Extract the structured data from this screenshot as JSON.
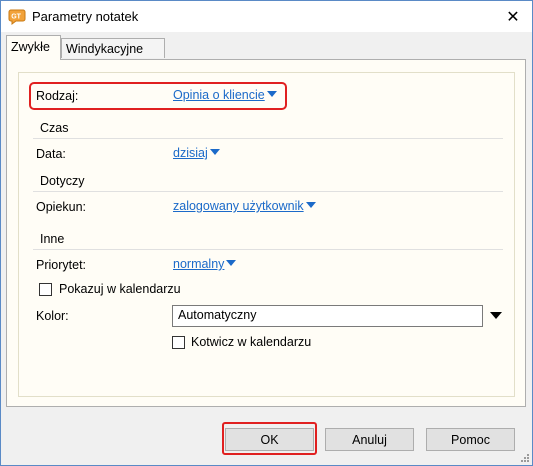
{
  "window": {
    "title": "Parametry notatek",
    "close_symbol": "✕"
  },
  "tabs": [
    {
      "label": "Zwykłe",
      "active": true
    },
    {
      "label": "Windykacyjne",
      "active": false
    }
  ],
  "form": {
    "rodzaj": {
      "label": "Rodzaj:",
      "value": "Opinia o kliencie"
    },
    "czas": {
      "section": "Czas",
      "data": {
        "label": "Data:",
        "value": "dzisiaj"
      }
    },
    "dotyczy": {
      "section": "Dotyczy",
      "opiekun": {
        "label": "Opiekun:",
        "value": "zalogowany użytkownik"
      }
    },
    "inne": {
      "section": "Inne",
      "priorytet": {
        "label": "Priorytet:",
        "value": "normalny"
      },
      "pokazuj": {
        "label": "Pokazuj w kalendarzu",
        "checked": false
      },
      "kolor": {
        "label": "Kolor:",
        "value": "Automatyczny"
      },
      "kotwicz": {
        "label": "Kotwicz w kalendarzu",
        "checked": false
      }
    }
  },
  "buttons": {
    "ok": "OK",
    "cancel": "Anuluj",
    "help": "Pomoc"
  },
  "colors": {
    "link": "#1b6ac9",
    "highlight": "#e02020",
    "panel_bg": "#fffdf6"
  }
}
